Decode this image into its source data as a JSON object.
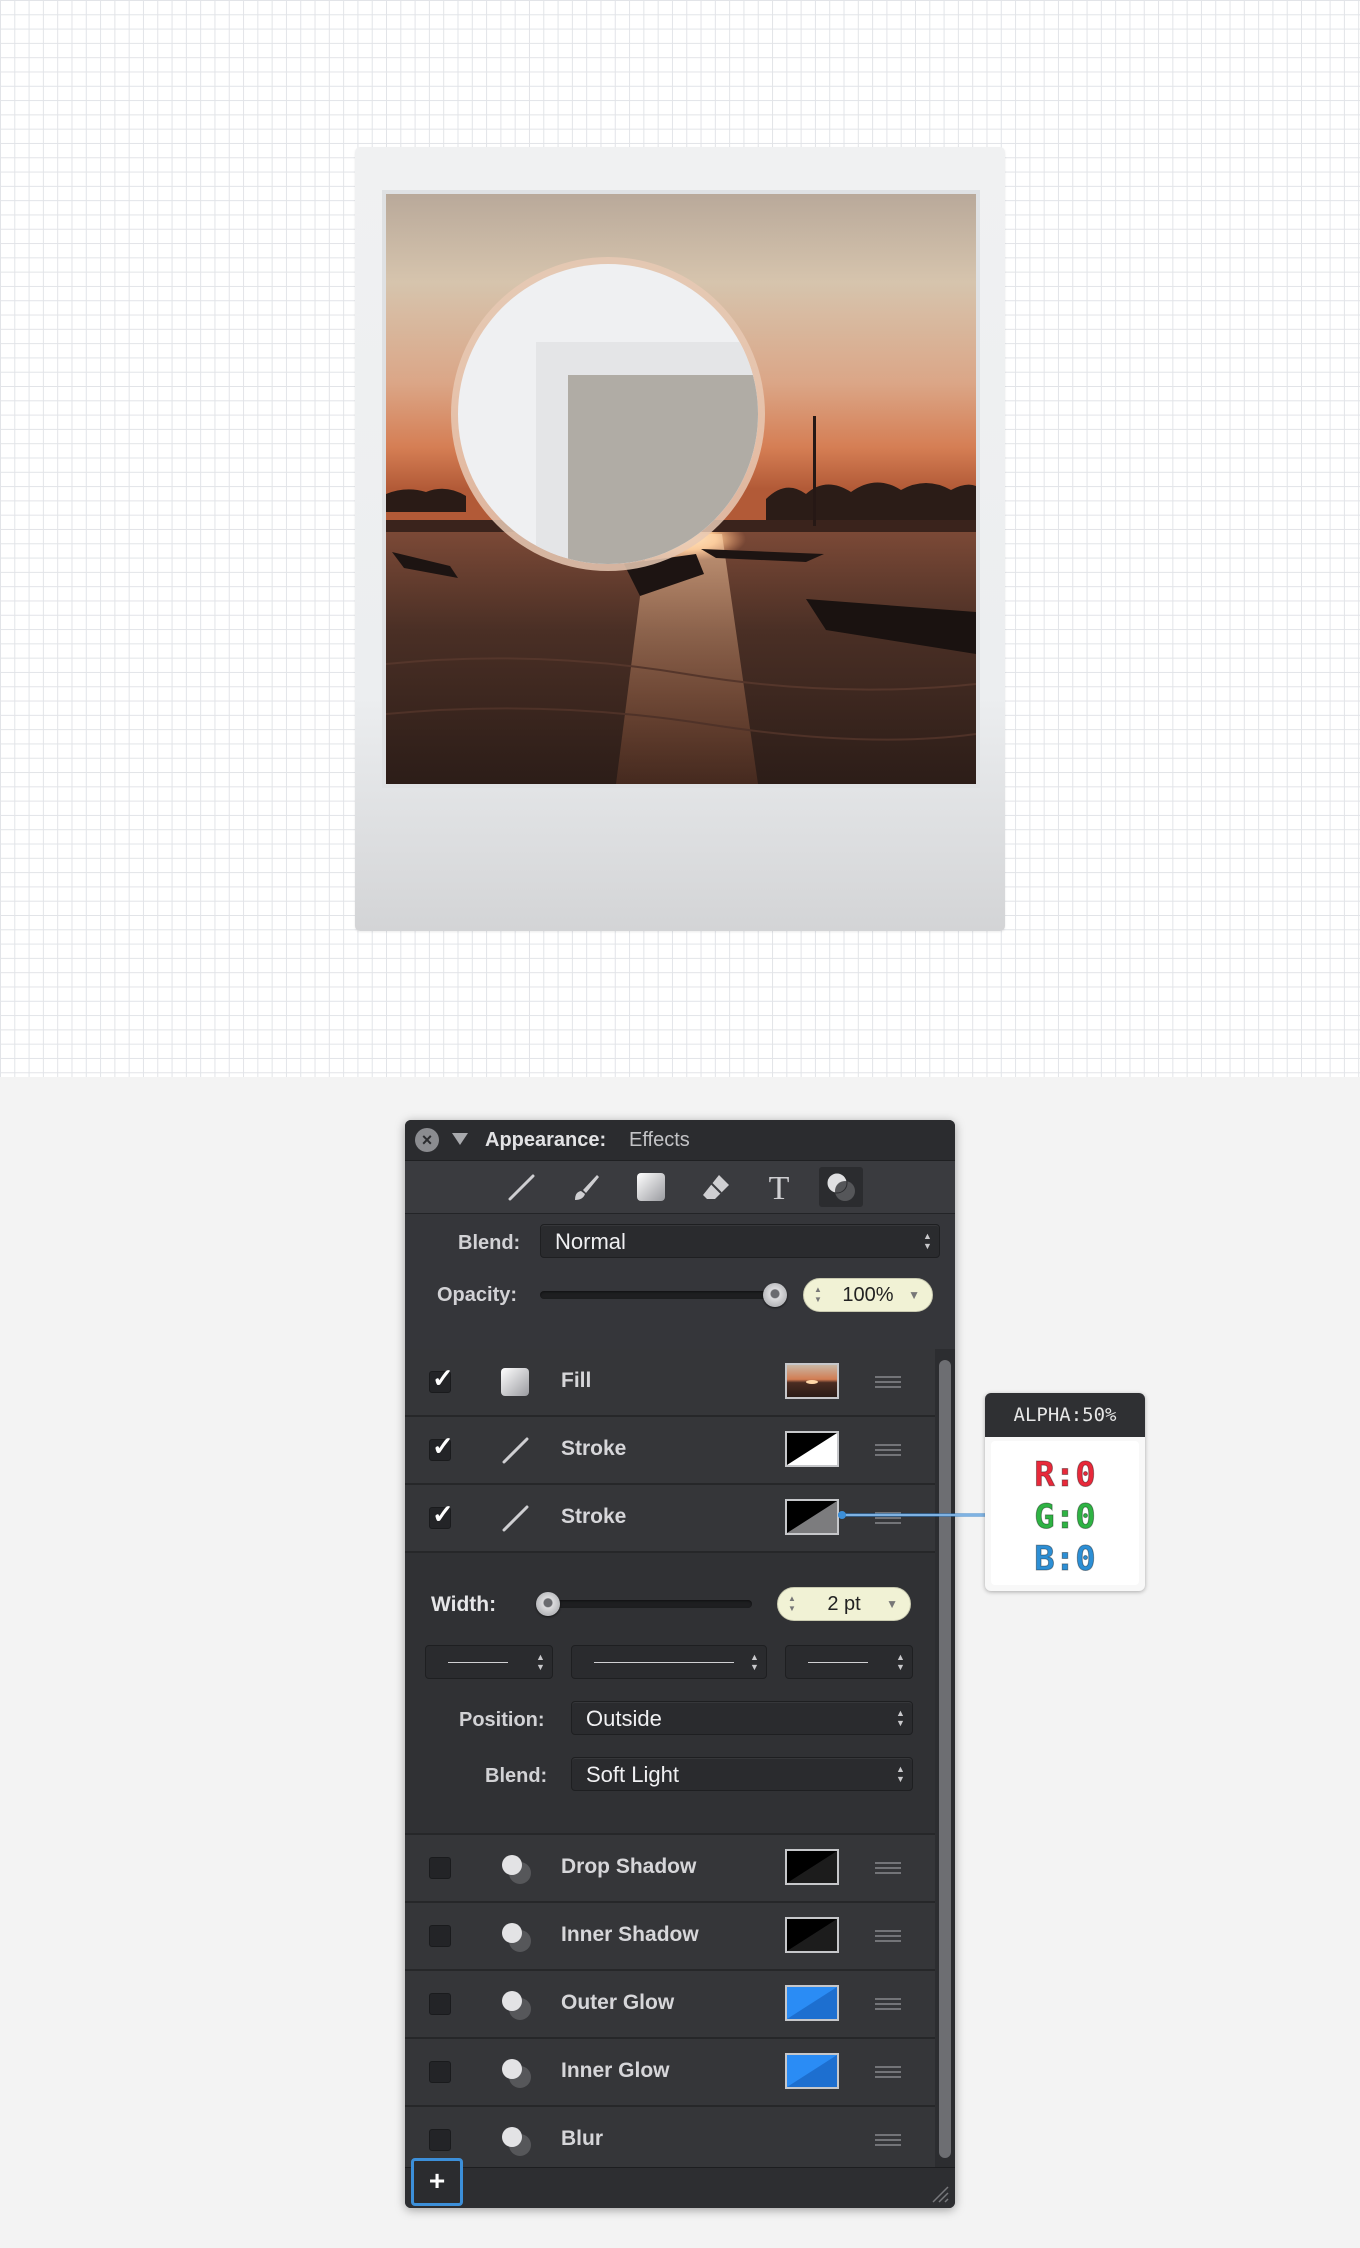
{
  "panel": {
    "title": "Appearance:",
    "subtitle": "Effects",
    "tools": [
      "stroke-line-icon",
      "brush-icon",
      "fill-square-icon",
      "eraser-icon",
      "text-icon",
      "effects-icon"
    ],
    "blend_label": "Blend:",
    "blend_value": "Normal",
    "opacity_label": "Opacity:",
    "opacity_value": "100%",
    "opacity_level": 1.0,
    "rows_top": [
      {
        "label": "Fill",
        "checked": true,
        "icon": "fill-square-icon",
        "swatch": "sunset-image"
      },
      {
        "label": "Stroke",
        "checked": true,
        "icon": "stroke-line-icon",
        "swatch": "black-white"
      },
      {
        "label": "Stroke",
        "checked": true,
        "icon": "stroke-line-icon",
        "swatch": "black-gray"
      }
    ],
    "stroke_detail": {
      "width_label": "Width:",
      "width_value": "2 pt",
      "position_label": "Position:",
      "position_value": "Outside",
      "blend_label": "Blend:",
      "blend_value": "Soft Light"
    },
    "rows_bottom": [
      {
        "label": "Drop Shadow",
        "checked": false,
        "icon": "effects-icon",
        "swatch": "black"
      },
      {
        "label": "Inner Shadow",
        "checked": false,
        "icon": "effects-icon",
        "swatch": "black"
      },
      {
        "label": "Outer Glow",
        "checked": false,
        "icon": "effects-icon",
        "swatch": "blue"
      },
      {
        "label": "Inner Glow",
        "checked": false,
        "icon": "effects-icon",
        "swatch": "blue"
      },
      {
        "label": "Blur",
        "checked": false,
        "icon": "effects-icon",
        "swatch": "none"
      }
    ],
    "add_label": "+"
  },
  "color_card": {
    "header": "ALPHA:50%",
    "r": "R:0",
    "g": "G:0",
    "b": "B:0",
    "r_color": "#e8293a",
    "g_color": "#2fb344",
    "b_color": "#2d8fd5"
  },
  "colors": {
    "panel_bg": "#35363a",
    "accent_blue": "#3c8fd9",
    "glow_blue": "#2a8cf5"
  }
}
